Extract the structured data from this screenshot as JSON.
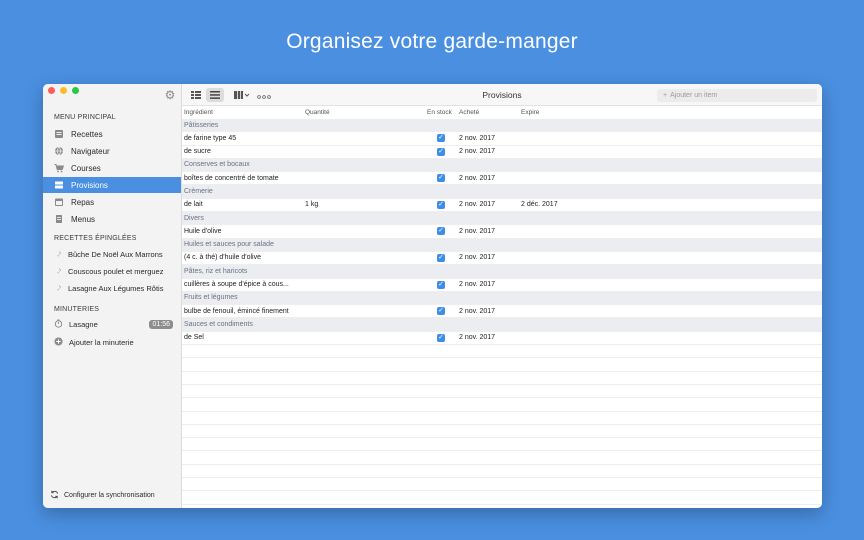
{
  "hero": {
    "title": "Organisez votre garde-manger"
  },
  "colors": {
    "background": "#4a8fe0",
    "accent": "#4a8fe0",
    "close": "#fc5f57",
    "minimize": "#fdbc2e",
    "zoom": "#28c840"
  },
  "sidebar": {
    "menu_header": "MENU PRINCIPAL",
    "items": [
      {
        "label": "Recettes",
        "icon": "book-icon"
      },
      {
        "label": "Navigateur",
        "icon": "globe-icon"
      },
      {
        "label": "Courses",
        "icon": "cart-icon"
      },
      {
        "label": "Provisions",
        "icon": "pantry-icon"
      },
      {
        "label": "Repas",
        "icon": "calendar-icon"
      },
      {
        "label": "Menus",
        "icon": "menu-list-icon"
      }
    ],
    "active_item": "Provisions",
    "pinned_header": "RECETTES ÉPINGLÉES",
    "pinned": [
      {
        "label": "Bûche De Noël Aux Marrons"
      },
      {
        "label": "Couscous poulet et merguez"
      },
      {
        "label": "Lasagne Aux Légumes Rôtis"
      }
    ],
    "timers_header": "MINUTERIES",
    "timers": [
      {
        "label": "Lasagne",
        "time": "01:56"
      }
    ],
    "add_timer_label": "Ajouter la minuterie",
    "sync_label": "Configurer la synchronisation"
  },
  "toolbar": {
    "title": "Provisions",
    "search_placeholder": "Ajouter un item"
  },
  "table": {
    "columns": [
      "Ingrédient",
      "Quantité",
      "En stock",
      "Acheté",
      "Expire"
    ],
    "rows": [
      {
        "category": "Pâtisseries"
      },
      {
        "ingredient": "de farine type 45",
        "quantity": "",
        "in_stock": true,
        "bought": "2 nov. 2017",
        "expires": ""
      },
      {
        "ingredient": "de sucre",
        "quantity": "",
        "in_stock": true,
        "bought": "2 nov. 2017",
        "expires": ""
      },
      {
        "category": "Conserves et bocaux"
      },
      {
        "ingredient": "boîtes de concentré de tomate",
        "quantity": "",
        "in_stock": true,
        "bought": "2 nov. 2017",
        "expires": ""
      },
      {
        "category": "Crèmerie"
      },
      {
        "ingredient": "de lait",
        "quantity": "1 kg",
        "in_stock": true,
        "bought": "2 nov. 2017",
        "expires": "2 déc. 2017"
      },
      {
        "category": "Divers"
      },
      {
        "ingredient": "Huile d'olive",
        "quantity": "",
        "in_stock": true,
        "bought": "2 nov. 2017",
        "expires": ""
      },
      {
        "category": "Huiles et sauces pour salade"
      },
      {
        "ingredient": "(4 c. à thé) d'huile d'olive",
        "quantity": "",
        "in_stock": true,
        "bought": "2 nov. 2017",
        "expires": ""
      },
      {
        "category": "Pâtes, riz et haricots"
      },
      {
        "ingredient": "cuillères à soupe d'épice à cous...",
        "quantity": "",
        "in_stock": true,
        "bought": "2 nov. 2017",
        "expires": ""
      },
      {
        "category": "Fruits et légumes"
      },
      {
        "ingredient": "bulbe de fenouil, émincé finement",
        "quantity": "",
        "in_stock": true,
        "bought": "2 nov. 2017",
        "expires": ""
      },
      {
        "category": "Sauces et condiments"
      },
      {
        "ingredient": "de Sel",
        "quantity": "",
        "in_stock": true,
        "bought": "2 nov. 2017",
        "expires": ""
      }
    ]
  }
}
